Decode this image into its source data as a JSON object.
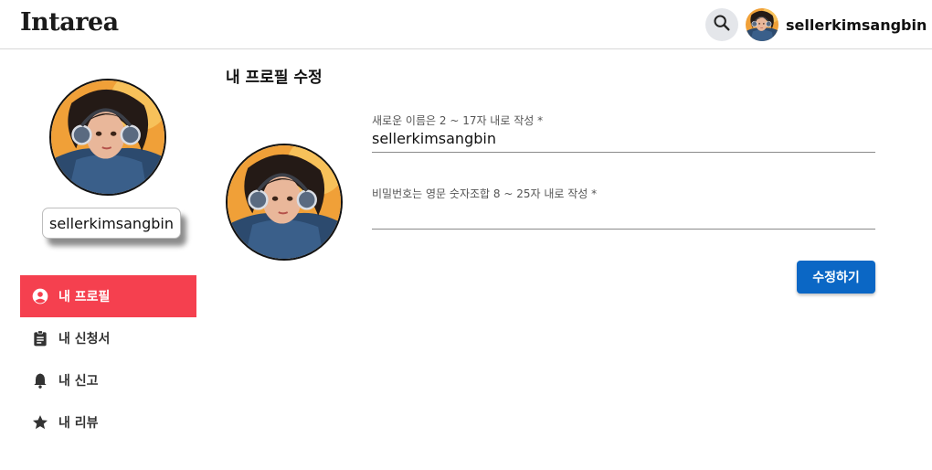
{
  "header": {
    "logo": "Intarea",
    "search_icon": "search-icon",
    "username": "sellerkimsangbin"
  },
  "sidebar": {
    "username": "sellerkimsangbin",
    "items": [
      {
        "label": "내 프로필",
        "icon": "account-circle-icon",
        "active": true
      },
      {
        "label": "내 신청서",
        "icon": "clipboard-icon",
        "active": false
      },
      {
        "label": "내 신고",
        "icon": "bell-icon",
        "active": false
      },
      {
        "label": "내 리뷰",
        "icon": "star-icon",
        "active": false
      }
    ]
  },
  "main": {
    "title": "내 프로필 수정",
    "name_field": {
      "label": "새로운 이름은 2 ~ 17자 내로 작성 *",
      "value": "sellerkimsangbin"
    },
    "password_field": {
      "label": "비밀번호는 영문 숫자조합 8 ~ 25자 내로 작성 *",
      "value": ""
    },
    "submit_label": "수정하기"
  },
  "colors": {
    "active_nav": "#f5404f",
    "primary_button": "#0b67c5",
    "search_bg": "#e4e6ea"
  }
}
